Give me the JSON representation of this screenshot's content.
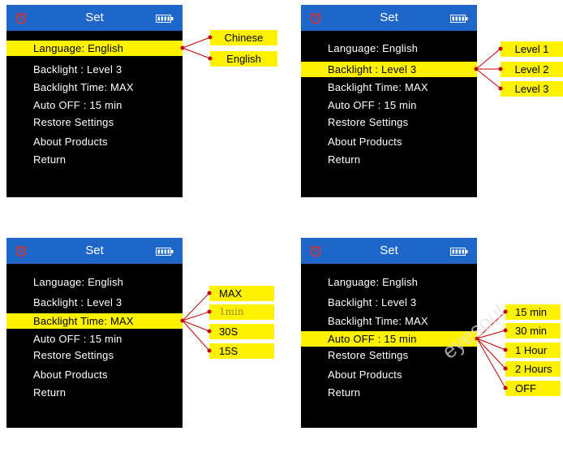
{
  "colors": {
    "header_bg": "#1e66c8",
    "screen_bg": "#000000",
    "highlight": "#fff200",
    "connector": "#c00000",
    "text": "#ffffff"
  },
  "icons": {
    "left": "alarm-clock-icon",
    "right": "battery-icon"
  },
  "header": {
    "title": "Set"
  },
  "menu": [
    "Language: English",
    "Backlight : Level 3",
    "Backlight Time: MAX",
    "Auto OFF : 15 min",
    "Restore Settings",
    "About Products",
    "Return"
  ],
  "panels": [
    {
      "selected_index": 0,
      "options": [
        "Chinese",
        "English"
      ]
    },
    {
      "selected_index": 1,
      "options": [
        "Level 1",
        "Level 2",
        "Level 3"
      ]
    },
    {
      "selected_index": 2,
      "options": [
        "MAX",
        "1min",
        "30S",
        "15S"
      ]
    },
    {
      "selected_index": 3,
      "options": [
        "15 min",
        "30 min",
        "1 Hour",
        "2 Hours",
        "OFF"
      ]
    }
  ],
  "watermark": {
    "text": "eyesoul"
  }
}
